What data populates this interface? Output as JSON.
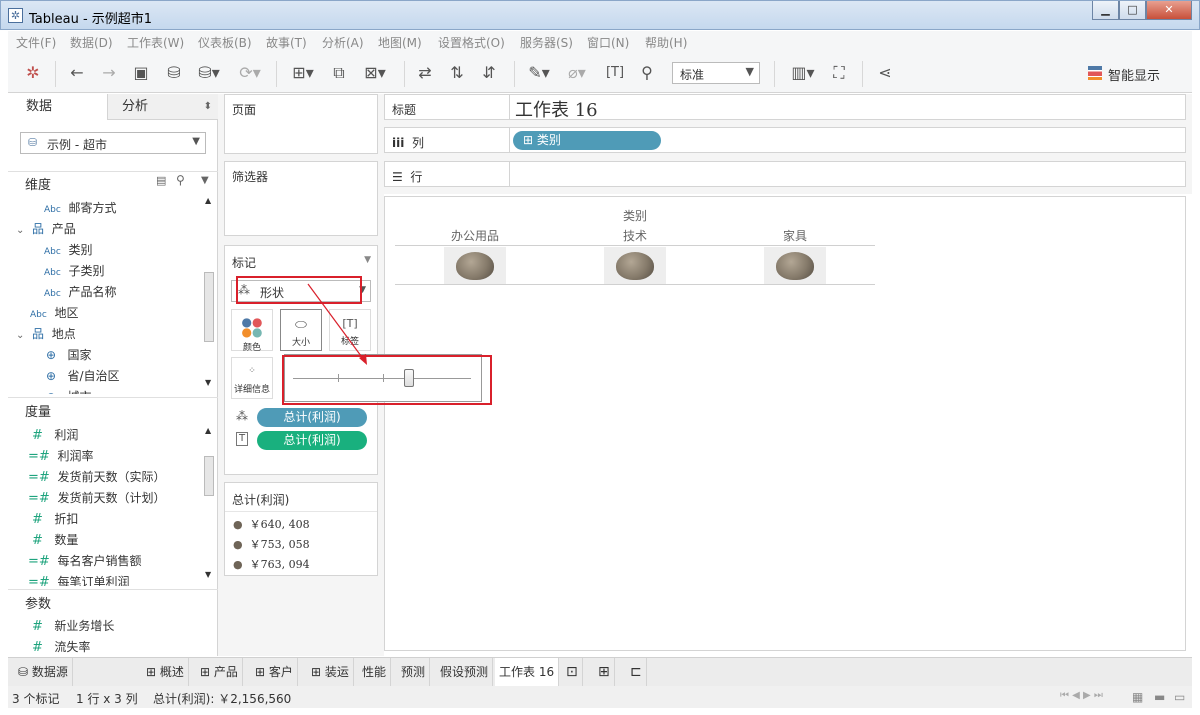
{
  "window": {
    "title": "Tableau - 示例超市1"
  },
  "menu": [
    "文件(F)",
    "数据(D)",
    "工作表(W)",
    "仪表板(B)",
    "故事(T)",
    "分析(A)",
    "地图(M)",
    "设置格式(O)",
    "服务器(S)",
    "窗口(N)",
    "帮助(H)"
  ],
  "toolbar": {
    "fit_select": "标准",
    "smart_display": "智能显示"
  },
  "left": {
    "tab_data": "数据",
    "tab_analysis": "分析",
    "datasource": "示例 - 超市",
    "dimensions_header": "维度",
    "dimensions": [
      {
        "icon": "Abc",
        "label": "邮寄方式",
        "indent": 2
      },
      {
        "icon": "hier",
        "label": "产品",
        "indent": 1
      },
      {
        "icon": "Abc",
        "label": "类别",
        "indent": 2
      },
      {
        "icon": "Abc",
        "label": "子类别",
        "indent": 2
      },
      {
        "icon": "Abc",
        "label": "产品名称",
        "indent": 2
      },
      {
        "icon": "Abc",
        "label": "地区",
        "indent": 1
      },
      {
        "icon": "hier",
        "label": "地点",
        "indent": 1
      },
      {
        "icon": "globe",
        "label": "国家",
        "indent": 2
      },
      {
        "icon": "globe",
        "label": "省/自治区",
        "indent": 2
      },
      {
        "icon": "globe",
        "label": "城市",
        "indent": 2
      }
    ],
    "measures_header": "度量",
    "measures": [
      {
        "icon": "#",
        "label": "利润"
      },
      {
        "icon": "=#",
        "label": "利润率"
      },
      {
        "icon": "=#",
        "label": "发货前天数（实际）"
      },
      {
        "icon": "=#",
        "label": "发货前天数（计划）"
      },
      {
        "icon": "#",
        "label": "折扣"
      },
      {
        "icon": "#",
        "label": "数量"
      },
      {
        "icon": "=#",
        "label": "每名客户销售额"
      },
      {
        "icon": "=#",
        "label": "每笔订单利润"
      }
    ],
    "params_header": "参数",
    "params": [
      {
        "icon": "#",
        "label": "新业务增长"
      },
      {
        "icon": "#",
        "label": "流失率"
      }
    ]
  },
  "cards": {
    "pages": "页面",
    "filters": "筛选器",
    "marks": "标记",
    "mark_type": "形状",
    "btn_color": "颜色",
    "btn_size": "大小",
    "btn_label": "标签",
    "btn_detail": "详细信息",
    "pill_shape": "总计(利润)",
    "pill_label": "总计(利润)",
    "legend_title": "总计(利润)",
    "legend_items": [
      "￥640, 408",
      "￥753, 058",
      "￥763, 094"
    ]
  },
  "shelves": {
    "title_label": "标题",
    "sheet_title": "工作表 16",
    "columns_label": "列",
    "columns_pill": "类别",
    "rows_label": "行"
  },
  "view": {
    "header_group": "类别",
    "categories": [
      "办公用品",
      "技术",
      "家具"
    ],
    "size_slider_fraction": 0.65
  },
  "tabs": [
    "数据源",
    "概述",
    "产品",
    "客户",
    "装运",
    "性能",
    "预测",
    "假设预测",
    "工作表 16"
  ],
  "status": {
    "marks": "3 个标记",
    "rows_cols": "1 行 x 3 列",
    "total": "总计(利润): ￥2,156,560"
  },
  "colors": {
    "pill_blue": "#4f9bb7",
    "pill_green": "#19b07e",
    "highlight_red": "#d9202b"
  }
}
